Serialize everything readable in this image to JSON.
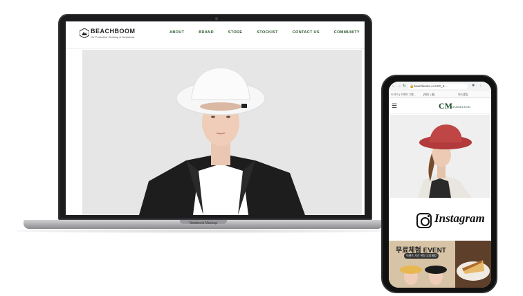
{
  "laptop": {
    "label": "Notebook Mockup",
    "site": {
      "logo_text": "BEACHBOOM",
      "logo_sub": "UV Protective Clothing & Swimwear",
      "nav": [
        "ABOUT",
        "BRAND",
        "STORE",
        "STOCKIST",
        "CONTACT US",
        "COMMUNITY"
      ]
    }
  },
  "phone": {
    "url": "beachboom.co.kr/#_3...",
    "bookmarks": [
      "드라이 | 브랜드그램...",
      "[메인 | 홈]",
      "워스롤링"
    ],
    "logo": "CM",
    "logo_sub": "CHAMELEON",
    "instagram_text": "Instagram",
    "event_title": "무료체험 EVENT",
    "event_sub": "이벤트 기간 한정 무료체험"
  },
  "colors": {
    "nav_green": "#2f5a2f",
    "brand_green": "#1e4d2b"
  },
  "icons": [
    "mountain-logo-icon",
    "menu-icon",
    "lock-icon",
    "instagram-icon",
    "back-icon",
    "forward-icon",
    "reload-icon",
    "extension-icon"
  ]
}
